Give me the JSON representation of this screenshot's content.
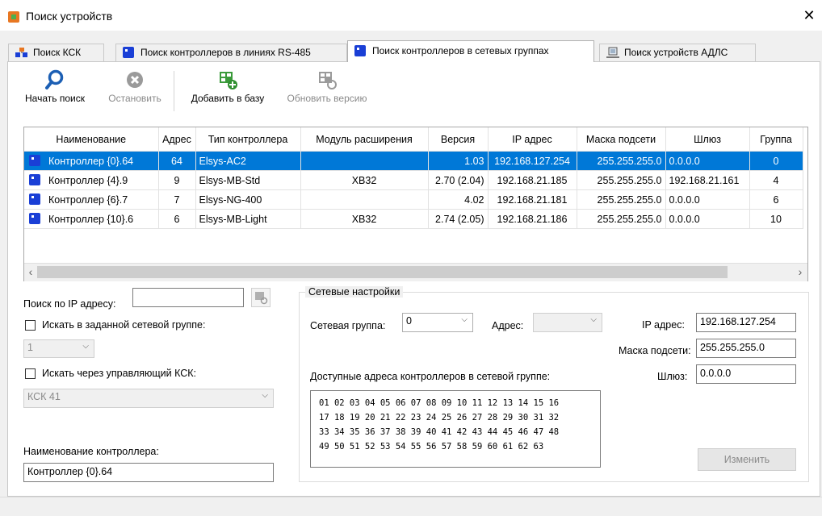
{
  "window": {
    "title": "Поиск устройств",
    "close": "✕"
  },
  "tabs": [
    {
      "label": "Поиск КСК"
    },
    {
      "label": "Поиск контроллеров в линиях RS-485"
    },
    {
      "label": "Поиск контроллеров в сетевых группах"
    },
    {
      "label": "Поиск устройств АДЛС"
    }
  ],
  "toolbar": {
    "start": "Начать поиск",
    "stop": "Остановить",
    "add": "Добавить в базу",
    "update": "Обновить версию"
  },
  "grid": {
    "columns": [
      "Наименование",
      "Адрес",
      "Тип контроллера",
      "Модуль расширения",
      "Версия",
      "IP адрес",
      "Маска подсети",
      "Шлюз",
      "Группа"
    ],
    "rows": [
      [
        "Контроллер {0}.64",
        "64",
        "Elsys-AC2",
        "",
        "1.03",
        "192.168.127.254",
        "255.255.255.0",
        "0.0.0.0",
        "0"
      ],
      [
        "Контроллер {4}.9",
        "9",
        "Elsys-MB-Std",
        "XB32",
        "2.70 (2.04)",
        "192.168.21.185",
        "255.255.255.0",
        "192.168.21.161",
        "4"
      ],
      [
        "Контроллер {6}.7",
        "7",
        "Elsys-NG-400",
        "",
        "4.02",
        "192.168.21.181",
        "255.255.255.0",
        "0.0.0.0",
        "6"
      ],
      [
        "Контроллер {10}.6",
        "6",
        "Elsys-MB-Light",
        "XB32",
        "2.74 (2.05)",
        "192.168.21.186",
        "255.255.255.0",
        "0.0.0.0",
        "10"
      ]
    ],
    "selected_row": 0
  },
  "left": {
    "ip_search_label": "Поиск по IP адресу:",
    "ip_search_value": "",
    "in_group_label": "Искать в заданной сетевой группе:",
    "group_value": "1",
    "via_ksk_label": "Искать через управляющий КСК:",
    "ksk_value": "КСК 41",
    "controller_name_label": "Наименование контроллера:",
    "controller_name_value": "Контроллер {0}.64"
  },
  "network": {
    "title": "Сетевые настройки",
    "group_label": "Сетевая группа:",
    "group_value": "0",
    "address_label": "Адрес:",
    "address_value": "",
    "ip_label": "IP адрес:",
    "ip_value": "192.168.127.254",
    "mask_label": "Маска подсети:",
    "mask_value": "255.255.255.0",
    "gateway_label": "Шлюз:",
    "gateway_value": "0.0.0.0",
    "available_label": "Доступные адреса контроллеров в сетевой группе:",
    "available_lines": [
      "01 02 03 04 05 06 07 08 09 10 11 12 13 14 15 16",
      "17 18 19 20 21 22 23 24 25 26 27 28 29 30 31 32",
      "33 34 35 36 37 38 39 40 41 42 43 44 45 46 47 48",
      "49 50 51 52 53 54 55 56 57 58 59 60 61 62 63"
    ],
    "change_button": "Изменить"
  }
}
